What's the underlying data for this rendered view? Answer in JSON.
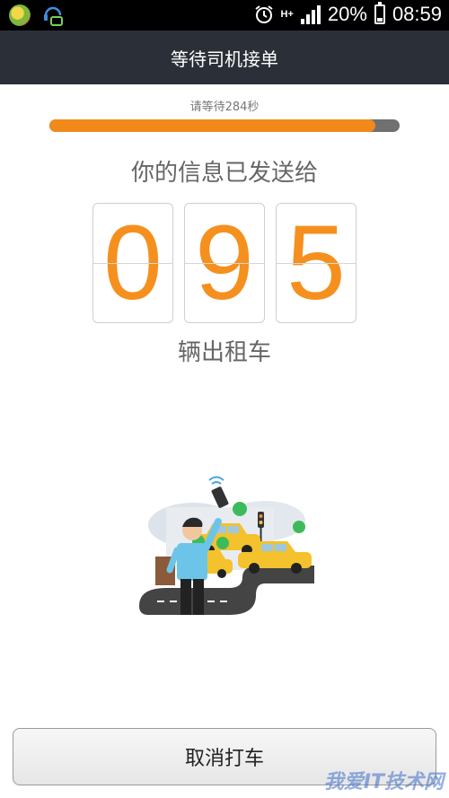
{
  "status_bar": {
    "network_label": "H+",
    "battery_text": "20%",
    "battery_level": 0.2,
    "time": "08:59",
    "icons": [
      "app-icon",
      "headset-chat-icon",
      "alarm-icon",
      "signal-icon",
      "battery-icon"
    ]
  },
  "header": {
    "title": "等待司机接单"
  },
  "wait": {
    "hint": "请等待284秒",
    "progress_fraction": 0.93
  },
  "main": {
    "info_sent": "你的信息已发送给",
    "digits": [
      "0",
      "9",
      "5"
    ],
    "car_count_label": "辆出租车"
  },
  "illustration": {
    "icon": "person-hailing-taxi-illustration"
  },
  "footer": {
    "cancel_label": "取消打车"
  },
  "watermark": {
    "text": "我爱IT技术网"
  },
  "colors": {
    "accent": "#f28a1a",
    "header_bg": "#2b3038",
    "taxi": "#f3c22c"
  }
}
